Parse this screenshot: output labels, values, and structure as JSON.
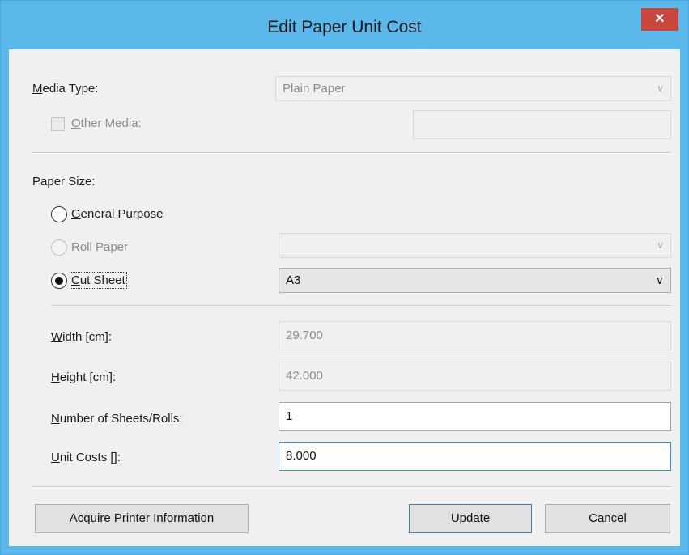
{
  "window": {
    "title": "Edit Paper Unit Cost",
    "close_glyph": "✕"
  },
  "media": {
    "label_key": "M",
    "label_rest": "edia Type:",
    "value": "Plain Paper",
    "other_key": "O",
    "other_rest": "ther Media:",
    "other_value": ""
  },
  "paper_size": {
    "label": "Paper Size:",
    "general_key": "G",
    "general_rest": "eneral Purpose",
    "roll_key": "R",
    "roll_rest": "oll Paper",
    "roll_value": "",
    "cut_key": "C",
    "cut_rest": "ut Sheet",
    "cut_value": "A3",
    "selected": "cut_sheet"
  },
  "dimensions": {
    "width_key": "W",
    "width_rest": "idth [cm]:",
    "width_value": "29.700",
    "height_key": "H",
    "height_rest": "eight [cm]:",
    "height_value": "42.000",
    "sheets_key": "N",
    "sheets_rest": "umber of Sheets/Rolls:",
    "sheets_value": "1",
    "cost_key": "U",
    "cost_rest": "nit Costs []:",
    "cost_value": "8.000"
  },
  "buttons": {
    "acquire_pre": "Acqui",
    "acquire_key": "r",
    "acquire_post": "e Printer Information",
    "update": "Update",
    "cancel": "Cancel"
  },
  "icons": {
    "close": "close-icon",
    "dropdown": "chevron-down-icon"
  }
}
